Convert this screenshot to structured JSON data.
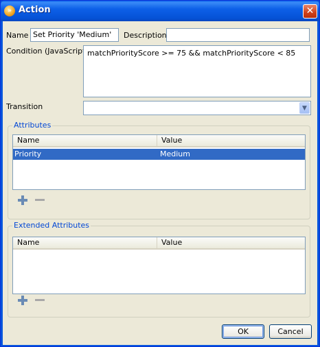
{
  "window": {
    "title": "Action",
    "close_symbol": "✕",
    "app_icon": "app-logo-icon",
    "icon_glyph": "»"
  },
  "form": {
    "name_label": "Name",
    "name_value": "Set Priority 'Medium'",
    "description_label": "Description",
    "description_value": "",
    "condition_label": "Condition (JavaScript)",
    "condition_value": "matchPriorityScore >= 75 && matchPriorityScore < 85",
    "transition_label": "Transition",
    "transition_value": "",
    "combo_arrow": "▼"
  },
  "attributes": {
    "title": "Attributes",
    "columns": [
      "Name",
      "Value"
    ],
    "rows": [
      {
        "name": "Priority",
        "value": "Medium",
        "selected": true
      }
    ]
  },
  "extended_attributes": {
    "title": "Extended Attributes",
    "columns": [
      "Name",
      "Value"
    ],
    "rows": []
  },
  "buttons": {
    "ok": "OK",
    "cancel": "Cancel"
  },
  "colors": {
    "selection": "#316AC5",
    "group_title": "#0046D5",
    "titlebar": "#0855DD"
  }
}
